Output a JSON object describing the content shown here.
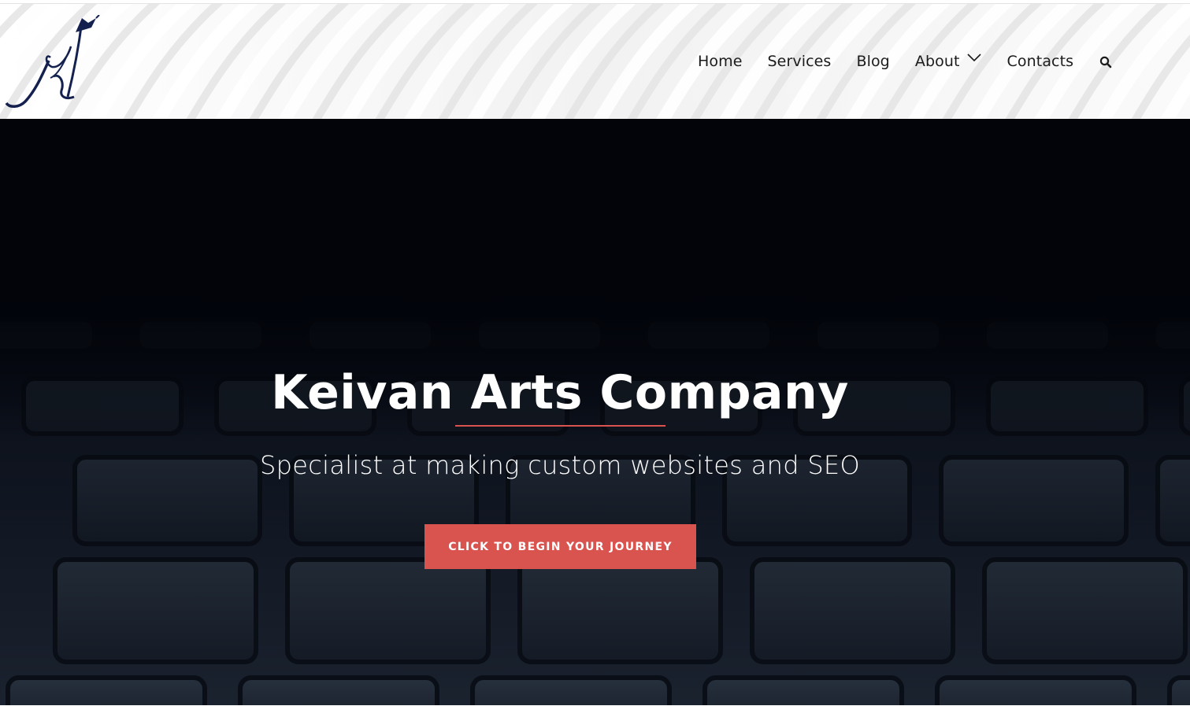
{
  "header": {
    "logo_alt": "KA",
    "nav": [
      {
        "label": "Home"
      },
      {
        "label": "Services"
      },
      {
        "label": "Blog"
      },
      {
        "label": "About",
        "has_dropdown": true
      },
      {
        "label": "Contacts"
      }
    ],
    "search_icon": "search-icon"
  },
  "hero": {
    "title": "Keivan Arts Company",
    "subtitle": "Specialist at making custom websites and SEO",
    "cta_label": "Click to begin your journey"
  },
  "colors": {
    "accent": "#d9534f",
    "logo_navy": "#14214f",
    "nav_text": "#1b1b1b",
    "hero_bg": "#05070f"
  }
}
